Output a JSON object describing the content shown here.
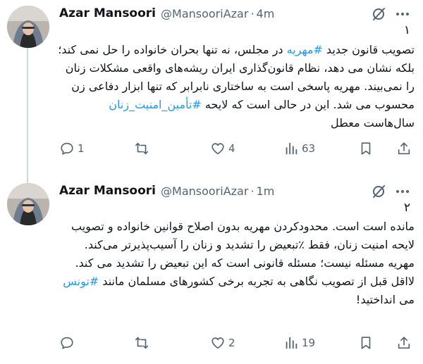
{
  "tweets": [
    {
      "author": "Azar Mansoori",
      "handle": "@MansooriAzar",
      "separator": "·",
      "time": "4m",
      "thread_number": "۱",
      "segments": [
        {
          "t": "تصویب قانون جدید ",
          "hl": false
        },
        {
          "t": "#مهریه",
          "hl": true
        },
        {
          "t": " در مجلس، نه تنها بحران خانواده را حل نمی کند؛ بلکه نشان می دهد، نظام قانون‌گذاری ایران ریشه‌های واقعی مشکلات زنان را نمی‌بیند. مهریه پاسخی است به ساختاری نابرابر که تنها ابزار دفاعی زن محسوب می شد. این در حالی است که لایحه ",
          "hl": false
        },
        {
          "t": "#تأمین_امنیت_زنان",
          "hl": true
        },
        {
          "t": " سال‌هاست معطل",
          "hl": false
        }
      ],
      "actions": {
        "replies": "1",
        "reposts": "",
        "likes": "4",
        "views": "63"
      }
    },
    {
      "author": "Azar Mansoori",
      "handle": "@MansooriAzar",
      "separator": "·",
      "time": "1m",
      "thread_number": "۲",
      "segments": [
        {
          "t": "مانده است است. محدودکردن مهریه بدون اصلاح قوانین خانواده و تصویب لایحه امنیت زنان، فقط ٪تبعیض را تشدید و زنان را آسیب‌پذیرتر می‌کند. مهریه مسئله نیست؛ مسئله قانونی است که این تبعیض را تشدید می کند. لااقل قبل از تصویب نگاهی به تجربه برخی کشورهای مسلمان مانند ",
          "hl": false
        },
        {
          "t": "#تونس",
          "hl": true
        },
        {
          "t": " می انداختید!",
          "hl": false
        }
      ],
      "actions": {
        "replies": "",
        "reposts": "",
        "likes": "2",
        "views": "19"
      }
    }
  ],
  "icons": [
    "reply-icon",
    "repost-icon",
    "like-icon",
    "views-icon",
    "bookmark-icon",
    "share-icon",
    "grok-icon",
    "more-icon"
  ],
  "colors": {
    "text": "#0f1419",
    "muted": "#536471",
    "link": "#1d9bf0",
    "thread_line": "#cfd9de"
  }
}
